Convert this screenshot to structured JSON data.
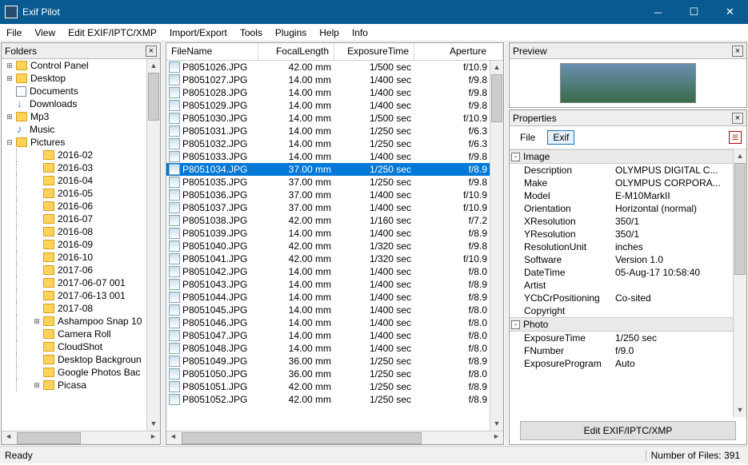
{
  "title": "Exif Pilot",
  "menu": [
    "File",
    "View",
    "Edit EXIF/IPTC/XMP",
    "Import/Export",
    "Tools",
    "Plugins",
    "Help",
    "Info"
  ],
  "panes": {
    "folders": "Folders",
    "preview": "Preview",
    "properties": "Properties"
  },
  "tree": [
    {
      "exp": "+",
      "ind": 0,
      "icon": "folder",
      "label": "Control Panel"
    },
    {
      "exp": "+",
      "ind": 0,
      "icon": "folder",
      "label": "Desktop"
    },
    {
      "exp": "",
      "ind": 0,
      "icon": "doc",
      "label": "Documents"
    },
    {
      "exp": "",
      "ind": 0,
      "icon": "dl",
      "label": "Downloads"
    },
    {
      "exp": "+",
      "ind": 0,
      "icon": "folder",
      "label": "Mp3"
    },
    {
      "exp": "",
      "ind": 0,
      "icon": "music",
      "label": "Music"
    },
    {
      "exp": "-",
      "ind": 0,
      "icon": "folder",
      "label": "Pictures"
    },
    {
      "exp": "",
      "ind": 1,
      "icon": "folder",
      "label": "2016-02"
    },
    {
      "exp": "",
      "ind": 1,
      "icon": "folder",
      "label": "2016-03"
    },
    {
      "exp": "",
      "ind": 1,
      "icon": "folder",
      "label": "2016-04"
    },
    {
      "exp": "",
      "ind": 1,
      "icon": "folder",
      "label": "2016-05"
    },
    {
      "exp": "",
      "ind": 1,
      "icon": "folder",
      "label": "2016-06"
    },
    {
      "exp": "",
      "ind": 1,
      "icon": "folder",
      "label": "2016-07"
    },
    {
      "exp": "",
      "ind": 1,
      "icon": "folder",
      "label": "2016-08"
    },
    {
      "exp": "",
      "ind": 1,
      "icon": "folder",
      "label": "2016-09"
    },
    {
      "exp": "",
      "ind": 1,
      "icon": "folder",
      "label": "2016-10"
    },
    {
      "exp": "",
      "ind": 1,
      "icon": "folder",
      "label": "2017-06"
    },
    {
      "exp": "",
      "ind": 1,
      "icon": "folder",
      "label": "2017-06-07 001"
    },
    {
      "exp": "",
      "ind": 1,
      "icon": "folder",
      "label": "2017-06-13 001"
    },
    {
      "exp": "",
      "ind": 1,
      "icon": "folder",
      "label": "2017-08"
    },
    {
      "exp": "+",
      "ind": 1,
      "icon": "folder",
      "label": "Ashampoo Snap 10"
    },
    {
      "exp": "",
      "ind": 1,
      "icon": "folder",
      "label": "Camera Roll"
    },
    {
      "exp": "",
      "ind": 1,
      "icon": "folder",
      "label": "CloudShot"
    },
    {
      "exp": "",
      "ind": 1,
      "icon": "folder",
      "label": "Desktop Backgroun"
    },
    {
      "exp": "",
      "ind": 1,
      "icon": "folder",
      "label": "Google Photos Bac"
    },
    {
      "exp": "+",
      "ind": 1,
      "icon": "folder",
      "label": "Picasa"
    }
  ],
  "columns": {
    "name": "FileName",
    "fl": "FocalLength",
    "et": "ExposureTime",
    "ap": "Aperture"
  },
  "files": [
    {
      "n": "P8051026.JPG",
      "fl": "42.00 mm",
      "et": "1/500 sec",
      "ap": "f/10.9"
    },
    {
      "n": "P8051027.JPG",
      "fl": "14.00 mm",
      "et": "1/400 sec",
      "ap": "f/9.8"
    },
    {
      "n": "P8051028.JPG",
      "fl": "14.00 mm",
      "et": "1/400 sec",
      "ap": "f/9.8"
    },
    {
      "n": "P8051029.JPG",
      "fl": "14.00 mm",
      "et": "1/400 sec",
      "ap": "f/9.8"
    },
    {
      "n": "P8051030.JPG",
      "fl": "14.00 mm",
      "et": "1/500 sec",
      "ap": "f/10.9"
    },
    {
      "n": "P8051031.JPG",
      "fl": "14.00 mm",
      "et": "1/250 sec",
      "ap": "f/6.3"
    },
    {
      "n": "P8051032.JPG",
      "fl": "14.00 mm",
      "et": "1/250 sec",
      "ap": "f/6.3"
    },
    {
      "n": "P8051033.JPG",
      "fl": "14.00 mm",
      "et": "1/400 sec",
      "ap": "f/9.8"
    },
    {
      "n": "P8051034.JPG",
      "fl": "37.00 mm",
      "et": "1/250 sec",
      "ap": "f/8.9",
      "sel": true
    },
    {
      "n": "P8051035.JPG",
      "fl": "37.00 mm",
      "et": "1/250 sec",
      "ap": "f/9.8"
    },
    {
      "n": "P8051036.JPG",
      "fl": "37.00 mm",
      "et": "1/400 sec",
      "ap": "f/10.9"
    },
    {
      "n": "P8051037.JPG",
      "fl": "37.00 mm",
      "et": "1/400 sec",
      "ap": "f/10.9"
    },
    {
      "n": "P8051038.JPG",
      "fl": "42.00 mm",
      "et": "1/160 sec",
      "ap": "f/7.2"
    },
    {
      "n": "P8051039.JPG",
      "fl": "14.00 mm",
      "et": "1/400 sec",
      "ap": "f/8.9"
    },
    {
      "n": "P8051040.JPG",
      "fl": "42.00 mm",
      "et": "1/320 sec",
      "ap": "f/9.8"
    },
    {
      "n": "P8051041.JPG",
      "fl": "42.00 mm",
      "et": "1/320 sec",
      "ap": "f/10.9"
    },
    {
      "n": "P8051042.JPG",
      "fl": "14.00 mm",
      "et": "1/400 sec",
      "ap": "f/8.0"
    },
    {
      "n": "P8051043.JPG",
      "fl": "14.00 mm",
      "et": "1/400 sec",
      "ap": "f/8.9"
    },
    {
      "n": "P8051044.JPG",
      "fl": "14.00 mm",
      "et": "1/400 sec",
      "ap": "f/8.9"
    },
    {
      "n": "P8051045.JPG",
      "fl": "14.00 mm",
      "et": "1/400 sec",
      "ap": "f/8.0"
    },
    {
      "n": "P8051046.JPG",
      "fl": "14.00 mm",
      "et": "1/400 sec",
      "ap": "f/8.0"
    },
    {
      "n": "P8051047.JPG",
      "fl": "14.00 mm",
      "et": "1/400 sec",
      "ap": "f/8.0"
    },
    {
      "n": "P8051048.JPG",
      "fl": "14.00 mm",
      "et": "1/400 sec",
      "ap": "f/8.0"
    },
    {
      "n": "P8051049.JPG",
      "fl": "36.00 mm",
      "et": "1/250 sec",
      "ap": "f/8.9"
    },
    {
      "n": "P8051050.JPG",
      "fl": "36.00 mm",
      "et": "1/250 sec",
      "ap": "f/8.0"
    },
    {
      "n": "P8051051.JPG",
      "fl": "42.00 mm",
      "et": "1/250 sec",
      "ap": "f/8.9"
    },
    {
      "n": "P8051052.JPG",
      "fl": "42.00 mm",
      "et": "1/250 sec",
      "ap": "f/8.9"
    }
  ],
  "propTabs": {
    "file": "File",
    "exif": "Exif"
  },
  "propGroups": [
    {
      "name": "Image",
      "rows": [
        {
          "k": "Description",
          "v": "OLYMPUS DIGITAL C..."
        },
        {
          "k": "Make",
          "v": "OLYMPUS CORPORA..."
        },
        {
          "k": "Model",
          "v": "E-M10MarkII"
        },
        {
          "k": "Orientation",
          "v": "Horizontal (normal)"
        },
        {
          "k": "XResolution",
          "v": "350/1"
        },
        {
          "k": "YResolution",
          "v": "350/1"
        },
        {
          "k": "ResolutionUnit",
          "v": "inches"
        },
        {
          "k": "Software",
          "v": "Version 1.0"
        },
        {
          "k": "DateTime",
          "v": "05-Aug-17 10:58:40"
        },
        {
          "k": "Artist",
          "v": ""
        },
        {
          "k": "YCbCrPositioning",
          "v": "Co-sited"
        },
        {
          "k": "Copyright",
          "v": ""
        }
      ]
    },
    {
      "name": "Photo",
      "rows": [
        {
          "k": "ExposureTime",
          "v": "1/250 sec"
        },
        {
          "k": "FNumber",
          "v": "f/9.0"
        },
        {
          "k": "ExposureProgram",
          "v": "Auto"
        }
      ]
    }
  ],
  "editBtn": "Edit EXIF/IPTC/XMP",
  "status": {
    "ready": "Ready",
    "count": "Number of Files: 391"
  }
}
